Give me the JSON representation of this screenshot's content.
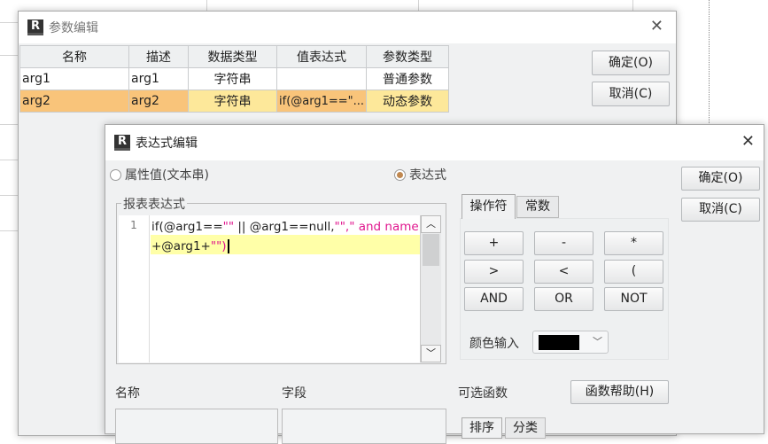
{
  "param_dialog": {
    "title": "参数编辑",
    "columns": [
      "名称",
      "描述",
      "数据类型",
      "值表达式",
      "参数类型"
    ],
    "rows": [
      {
        "name": "arg1",
        "desc": "arg1",
        "type": "字符串",
        "expr": "",
        "ptype": "普通参数"
      },
      {
        "name": "arg2",
        "desc": "arg2",
        "type": "字符串",
        "expr": "if(@arg1==\"...",
        "ptype": "动态参数"
      }
    ],
    "ok": "确定(O)",
    "cancel": "取消(C)"
  },
  "expr_dialog": {
    "title": "表达式编辑",
    "radio_text": "属性值(文本串)",
    "radio_expr": "表达式",
    "group_label": "报表表达式",
    "line_number": "1",
    "code_line1": {
      "a": "if(@arg1==",
      "b": "\"\"",
      "c": " || @arg1==null,",
      "d": "\"\",\" and name=\"",
      "e": ""
    },
    "code_line2": {
      "a": "+@arg1+",
      "b": "\"\")"
    },
    "tabs": [
      "操作符",
      "常数"
    ],
    "operators": [
      "+",
      "-",
      "*",
      ">",
      "<",
      "(",
      "AND",
      "OR",
      "NOT"
    ],
    "color_label": "颜色输入",
    "color_value": "#000000",
    "ok": "确定(O)",
    "cancel": "取消(C)",
    "name_label": "名称",
    "field_label": "字段",
    "func_label": "可选函数",
    "func_help": "函数帮助(H)",
    "func_tabs": [
      "排序",
      "分类"
    ]
  }
}
